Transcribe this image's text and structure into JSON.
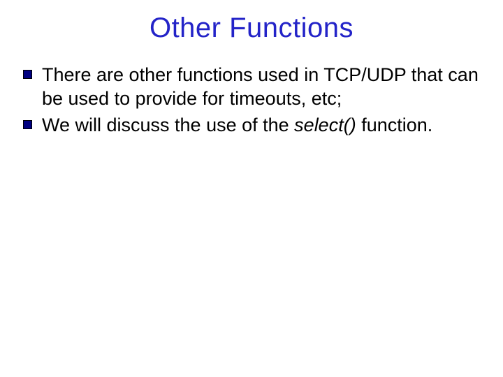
{
  "title": "Other Functions",
  "bullets": [
    {
      "pre": "There are other functions used in TCP/UDP that can be used to provide for timeouts, etc;"
    },
    {
      "pre": "We will discuss the use of the ",
      "italic": "select()",
      "post": " function."
    }
  ]
}
